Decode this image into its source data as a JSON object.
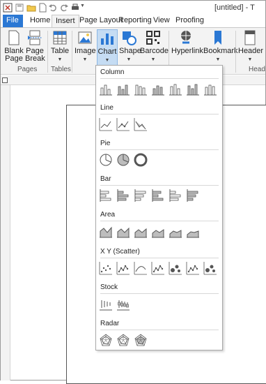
{
  "window": {
    "title": "[untitled] - T"
  },
  "tabs": [
    "File",
    "Home",
    "Insert",
    "Page Layout",
    "Reporting",
    "View",
    "Proofing"
  ],
  "ribbon": {
    "blank_page": "Blank\nPage",
    "page_break": "Page\nBreak",
    "table": "Table",
    "image": "Image",
    "chart": "Chart",
    "shape": "Shape",
    "barcode": "Barcode",
    "hyperlink": "Hyperlink",
    "bookmark": "Bookmark",
    "header": "Header",
    "group_pages": "Pages",
    "group_tables": "Tables",
    "group_header": "Head"
  },
  "chart_menu": {
    "sections": [
      {
        "title": "Column",
        "count": 7
      },
      {
        "title": "Line",
        "count": 3
      },
      {
        "title": "Pie",
        "count": 3
      },
      {
        "title": "Bar",
        "count": 6
      },
      {
        "title": "Area",
        "count": 6
      },
      {
        "title": "X Y (Scatter)",
        "count": 7
      },
      {
        "title": "Stock",
        "count": 2
      },
      {
        "title": "Radar",
        "count": 3
      }
    ]
  },
  "colors": {
    "accent": "#2b78d4",
    "pressed": "#c5dcf3",
    "icon": "#555555",
    "icon_fill": "#bdbdbd"
  }
}
